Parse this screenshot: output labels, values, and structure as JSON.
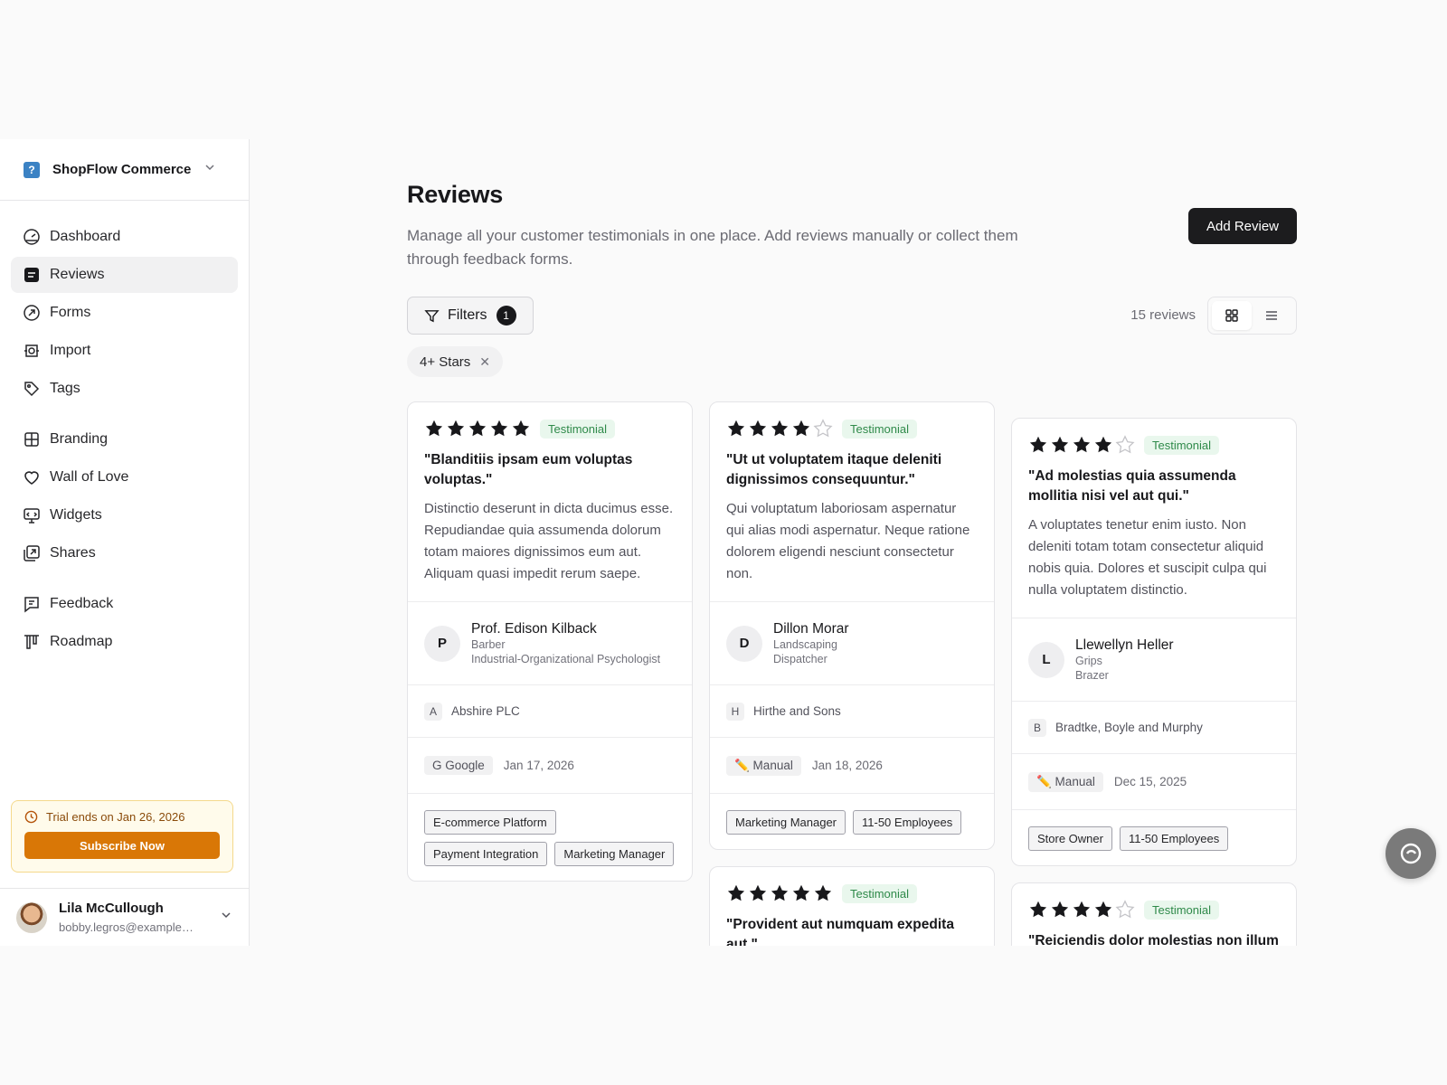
{
  "org": {
    "name": "ShopFlow Commerce",
    "logo": "?"
  },
  "nav": [
    {
      "label": "Dashboard",
      "icon": "dashboard-icon"
    },
    {
      "label": "Reviews",
      "icon": "reviews-icon",
      "active": true
    },
    {
      "label": "Forms",
      "icon": "forms-icon"
    },
    {
      "label": "Import",
      "icon": "import-icon"
    },
    {
      "label": "Tags",
      "icon": "tags-icon"
    },
    {
      "label": "Branding",
      "icon": "branding-icon"
    },
    {
      "label": "Wall of Love",
      "icon": "heart-icon"
    },
    {
      "label": "Widgets",
      "icon": "widgets-icon"
    },
    {
      "label": "Shares",
      "icon": "shares-icon"
    },
    {
      "label": "Feedback",
      "icon": "feedback-icon"
    },
    {
      "label": "Roadmap",
      "icon": "roadmap-icon"
    }
  ],
  "trial": {
    "text": "Trial ends on Jan 26, 2026",
    "button": "Subscribe Now"
  },
  "user": {
    "name": "Lila McCullough",
    "email": "bobby.legros@example.com"
  },
  "page": {
    "title": "Reviews",
    "subtitle": "Manage all your customer testimonials in one place. Add reviews manually or collect them through feedback forms.",
    "add_button": "Add Review",
    "filters_label": "Filters",
    "filters_count": "1",
    "review_count": "15 reviews",
    "active_filter": "4+ Stars"
  },
  "reviews": [
    {
      "rating": 5,
      "badge": "Testimonial",
      "title": "\"Blanditiis ipsam eum voluptas voluptas.\"",
      "body": "Distinctio deserunt in dicta ducimus esse. Repudiandae quia assumenda dolorum totam maiores dignissimos eum aut. Aliquam quasi impedit rerum saepe.",
      "initial": "P",
      "name": "Prof. Edison Kilback",
      "role": "Barber",
      "role2": "Industrial-Organizational Psychologist",
      "company_initial": "A",
      "company": "Abshire PLC",
      "source": "G Google",
      "date": "Jan 17, 2026",
      "tags": [
        "E-commerce Platform",
        "Payment Integration",
        "Marketing Manager"
      ]
    },
    {
      "rating": 4,
      "badge": "Testimonial",
      "title": "\"Ut ut voluptatem itaque deleniti dignissimos consequuntur.\"",
      "body": "Qui voluptatum laboriosam aspernatur qui alias modi aspernatur. Neque ratione dolorem eligendi nesciunt consectetur non.",
      "initial": "D",
      "name": "Dillon Morar",
      "role": "Landscaping",
      "role2": "Dispatcher",
      "company_initial": "H",
      "company": "Hirthe and Sons",
      "source": "✏️ Manual",
      "date": "Jan 18, 2026",
      "tags": [
        "Marketing Manager",
        "11-50 Employees"
      ]
    },
    {
      "rating": 4,
      "badge": "Testimonial",
      "title": "\"Ad molestias quia assumenda mollitia nisi vel aut qui.\"",
      "body": "A voluptates tenetur enim iusto. Non deleniti totam totam consectetur aliquid nobis quia. Dolores et suscipit culpa qui nulla voluptatem distinctio.",
      "initial": "L",
      "name": "Llewellyn Heller",
      "role": "Grips",
      "role2": "Brazer",
      "company_initial": "B",
      "company": "Bradtke, Boyle and Murphy",
      "source": "✏️ Manual",
      "date": "Dec 15, 2025",
      "tags": [
        "Store Owner",
        "11-50 Employees"
      ]
    },
    {
      "rating": 5,
      "badge": "Testimonial",
      "title": "\"Provident aut numquam expedita aut.\""
    },
    {
      "rating": 4,
      "badge": "Testimonial",
      "title": "\"Reiciendis dolor molestias non illum"
    }
  ]
}
